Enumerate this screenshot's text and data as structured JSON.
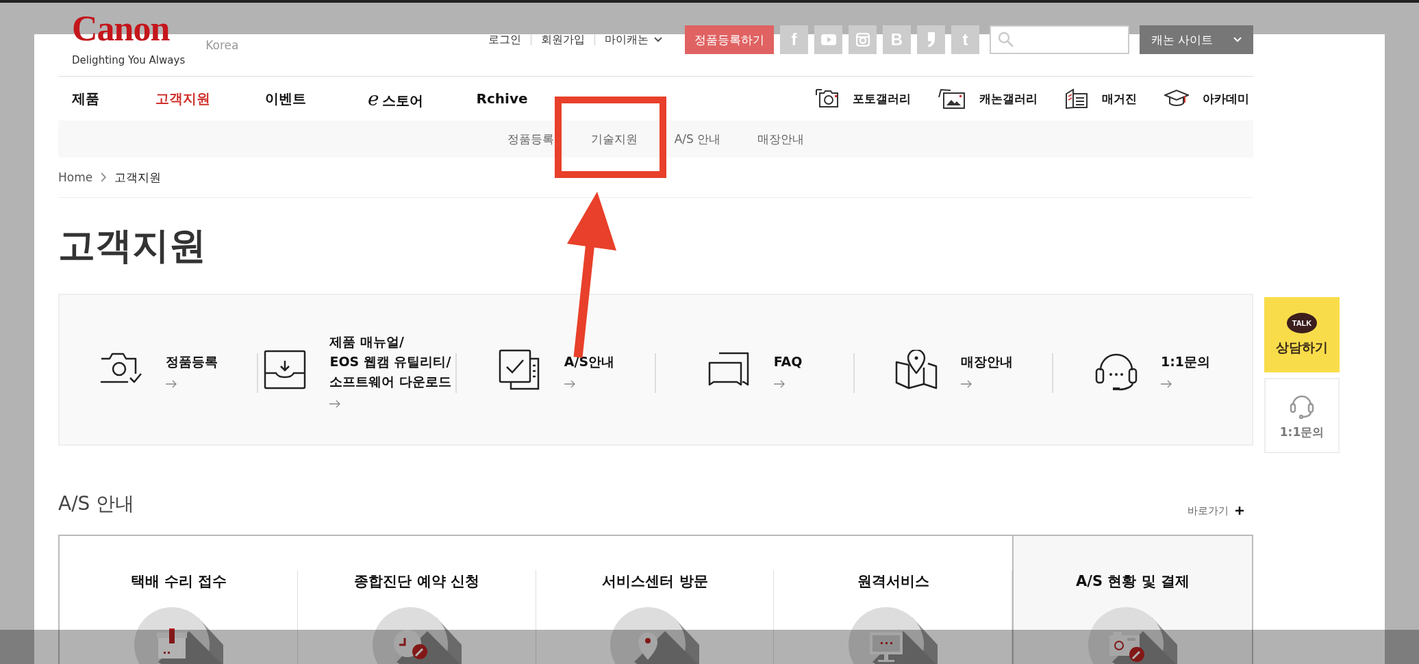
{
  "header": {
    "logo": "Canon",
    "tagline": "Delighting You Always",
    "region": "Korea",
    "top_links": [
      {
        "label": "로그인",
        "kind": "plain"
      },
      {
        "label": "회원가입",
        "kind": "plain"
      },
      {
        "label": "마이캐논",
        "kind": "menu"
      }
    ],
    "register_button": "정품등록하기",
    "social": [
      {
        "kind": "glyph",
        "glyph": "f"
      },
      {
        "kind": "youtube"
      },
      {
        "kind": "instagram"
      },
      {
        "kind": "glyph",
        "glyph": "B"
      },
      {
        "kind": "quote"
      },
      {
        "kind": "glyph",
        "glyph": "t"
      }
    ],
    "site_button": "캐논 사이트"
  },
  "main_nav": [
    {
      "label": "제품",
      "selected": false
    },
    {
      "label": "고객지원",
      "selected": true
    },
    {
      "label": "이벤트",
      "selected": false
    },
    {
      "prefix": "e",
      "label": "스토어",
      "selected": false
    },
    {
      "label": "Rchive",
      "selected": false
    }
  ],
  "gallery_nav": [
    {
      "kind": "photo",
      "label": "포토갤러리"
    },
    {
      "kind": "gallery",
      "label": "캐논갤러리"
    },
    {
      "kind": "magazine",
      "label": "매거진"
    },
    {
      "kind": "academy",
      "label": "아카데미"
    }
  ],
  "sub_nav": [
    "정품등록",
    "기술지원",
    "A/S 안내",
    "매장안내"
  ],
  "breadcrumb": [
    "Home",
    "고객지원"
  ],
  "page_title": "고객지원",
  "quick_links": [
    {
      "kind": "camera",
      "lines": [
        "정품등록"
      ]
    },
    {
      "kind": "download",
      "lines": [
        "제품 매뉴얼/",
        "EOS 웹캠 유틸리티/",
        "소프트웨어 다운로드"
      ]
    },
    {
      "kind": "checklist",
      "lines": [
        "A/S안내"
      ]
    },
    {
      "kind": "chat",
      "lines": [
        "FAQ"
      ]
    },
    {
      "kind": "map",
      "lines": [
        "매장안내"
      ]
    },
    {
      "kind": "headset",
      "lines": [
        "1:1문의"
      ]
    }
  ],
  "side_buttons": [
    {
      "kind": "talk",
      "badge": "TALK",
      "label": "상담하기"
    },
    {
      "kind": "headset",
      "label": "1:1문의"
    }
  ],
  "as_section": {
    "title": "A/S 안내",
    "more": "바로가기",
    "cards": [
      {
        "kind": "box",
        "title": "택배 수리 접수",
        "selected": false
      },
      {
        "kind": "clock",
        "title": "종합진단 예약 신청",
        "selected": false
      },
      {
        "kind": "pin",
        "title": "서비스센터 방문",
        "selected": false
      },
      {
        "kind": "monitor",
        "title": "원격서비스",
        "selected": false
      },
      {
        "kind": "camera",
        "title": "A/S 현황 및 결제",
        "selected": true
      }
    ]
  }
}
